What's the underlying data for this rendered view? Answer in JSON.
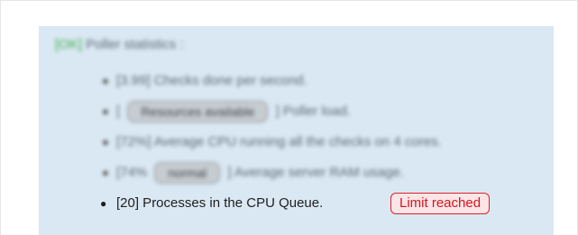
{
  "poller": {
    "status": "[OK]",
    "title": "Poller statistics :"
  },
  "stats": {
    "checks": {
      "text": "[3.99] Checks done per second."
    },
    "load": {
      "prefix": "[",
      "badge": "Resources available",
      "suffix": "] Poller load."
    },
    "cpu": {
      "text": "[72%] Average CPU running all the checks on 4 cores."
    },
    "ram": {
      "prefix": "[74%",
      "badge": "normal",
      "suffix": "] Average server RAM usage."
    }
  },
  "queue": {
    "text": "[20] Processes in the CPU Queue.",
    "badge": "Limit reached"
  },
  "colors": {
    "panel_background": "#dae8f3",
    "ok_green": "#3fae4a",
    "alert_red": "#d8131e",
    "alert_background": "#fbe5e6"
  }
}
